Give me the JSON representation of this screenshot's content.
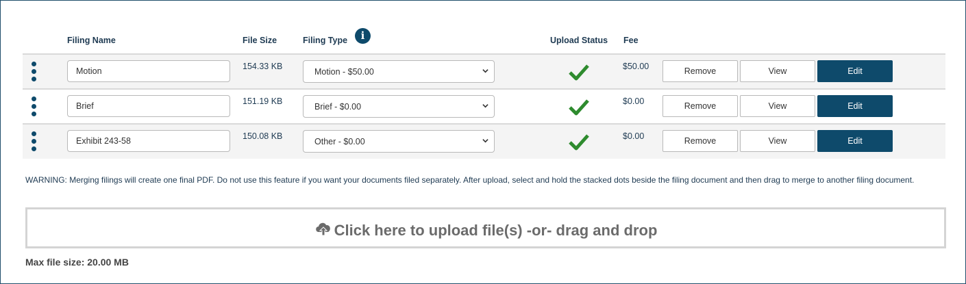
{
  "table": {
    "headers": {
      "filing_name": "Filing Name",
      "file_size": "File Size",
      "filing_type": "Filing Type",
      "upload_status": "Upload Status",
      "fee": "Fee"
    },
    "info_icon": "info-icon",
    "rows": [
      {
        "name": "Motion",
        "file_size": "154.33 KB",
        "filing_type": "Motion - $50.00",
        "status": "check-icon",
        "fee": "$50.00"
      },
      {
        "name": "Brief",
        "file_size": "151.19 KB",
        "filing_type": "Brief - $0.00",
        "status": "check-icon",
        "fee": "$0.00"
      },
      {
        "name": "Exhibit 243-58",
        "file_size": "150.08 KB",
        "filing_type": "Other - $0.00",
        "status": "check-icon",
        "fee": "$0.00"
      }
    ],
    "actions": {
      "remove": "Remove",
      "view": "View",
      "edit": "Edit"
    }
  },
  "warning": "WARNING: Merging filings will create one final PDF. Do not use this feature if you want your documents filed separately. After upload, select and hold the stacked dots beside the filing document and then drag to merge to another filing document.",
  "upload": {
    "label": "Click here to upload file(s) -or- drag and drop",
    "icon": "cloud-upload-icon",
    "max_size": "Max file size: 20.00 MB"
  },
  "colors": {
    "primary": "#0e4a6b",
    "check": "#2e8b2e",
    "row_shade": "#f4f4f4"
  }
}
